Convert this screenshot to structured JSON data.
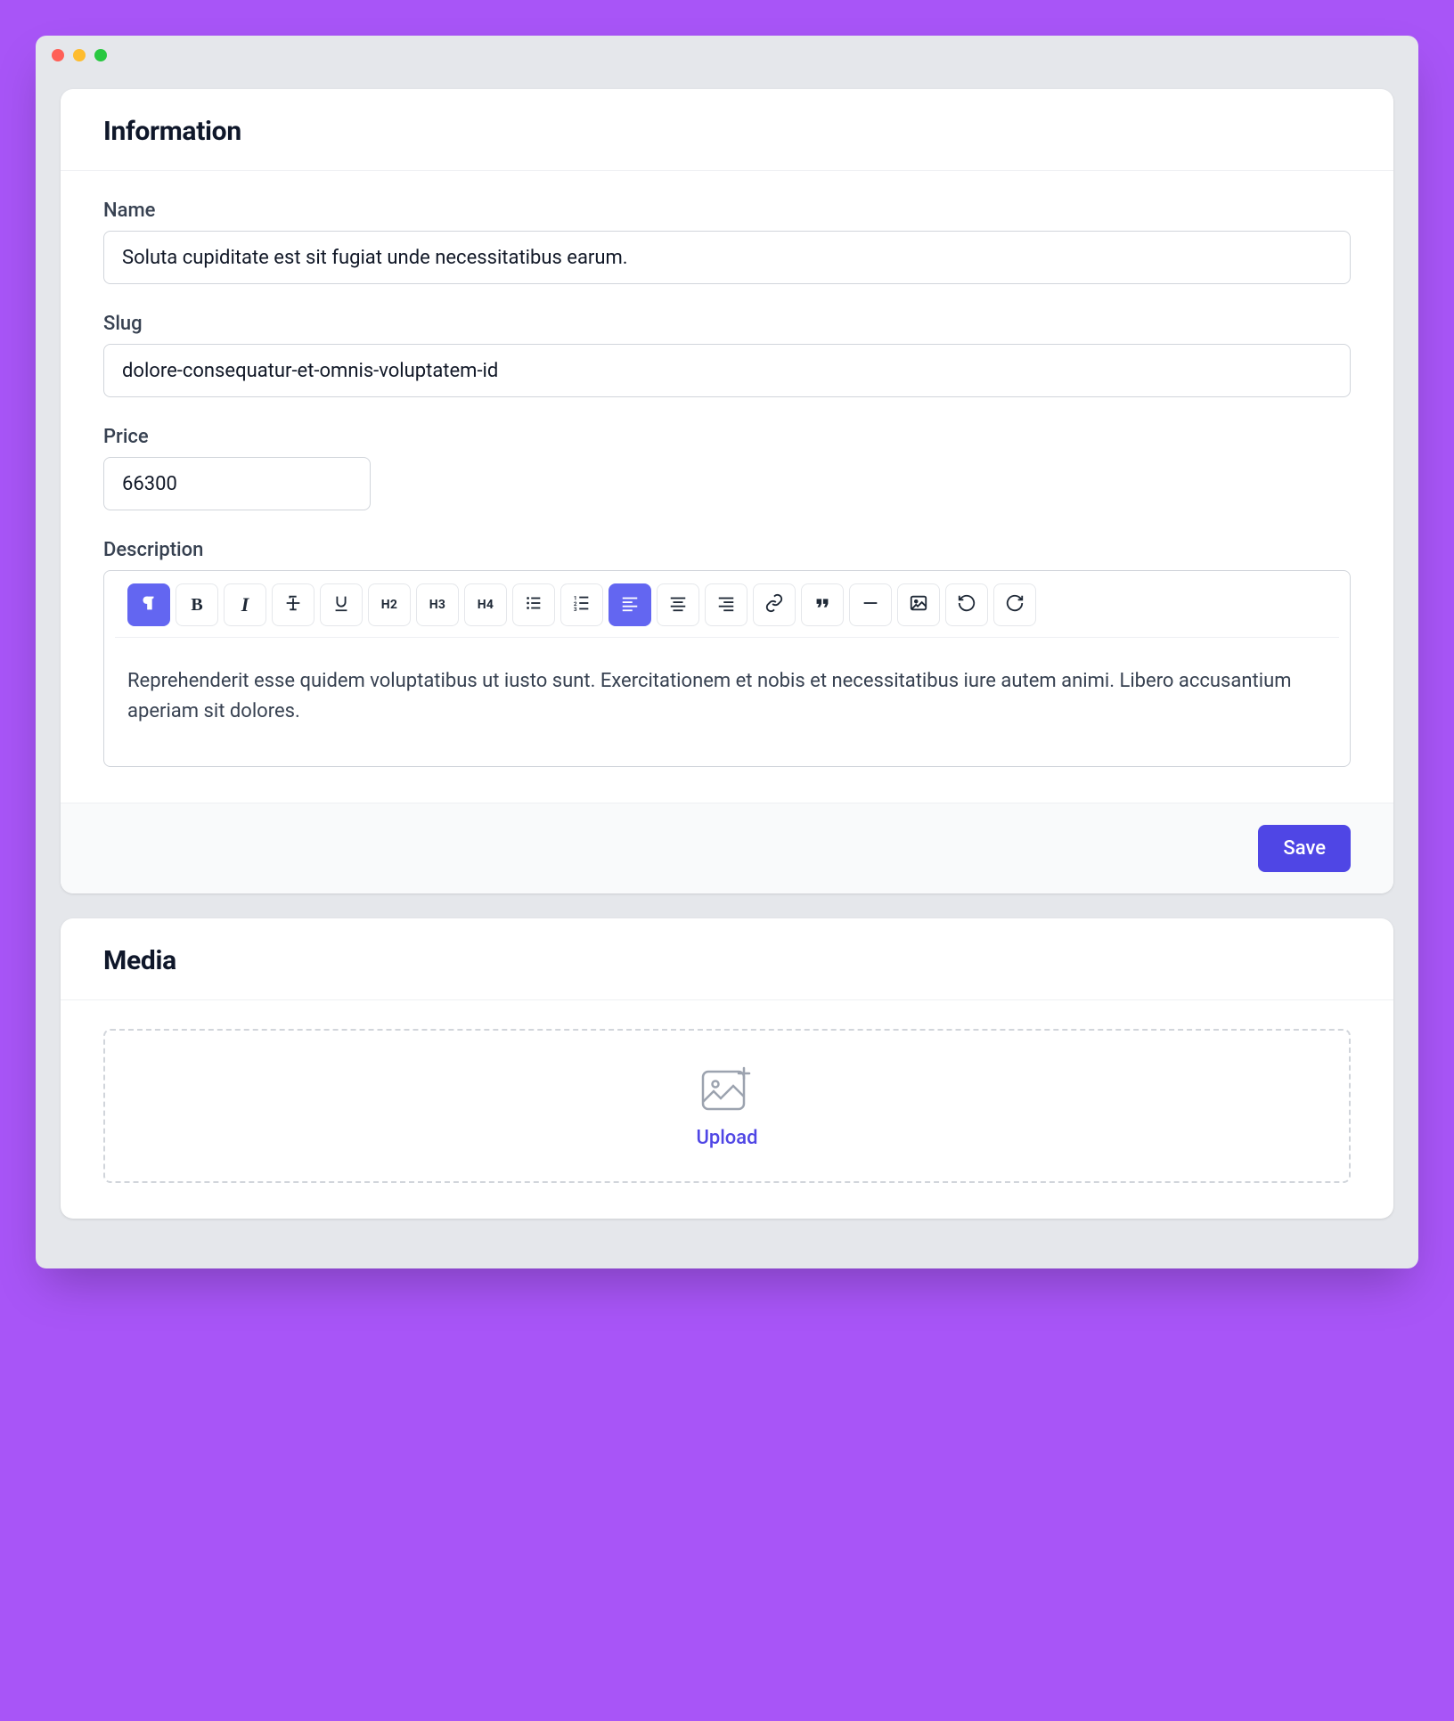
{
  "cards": {
    "information": {
      "title": "Information",
      "fields": {
        "name": {
          "label": "Name",
          "value": "Soluta cupiditate est sit fugiat unde necessitatibus earum."
        },
        "slug": {
          "label": "Slug",
          "value": "dolore-consequatur-et-omnis-voluptatem-id"
        },
        "price": {
          "label": "Price",
          "value": "66300"
        },
        "description": {
          "label": "Description",
          "value": "Reprehenderit esse quidem voluptatibus ut iusto sunt. Exercitationem et nobis et necessitatibus iure autem animi. Libero accusantium aperiam sit dolores."
        }
      },
      "toolbar": {
        "paragraph": {
          "icon": "paragraph-icon",
          "active": true
        },
        "bold": {
          "label": "B"
        },
        "italic": {
          "label": "I"
        },
        "strike": {
          "label": "S"
        },
        "underline": {
          "label": "U"
        },
        "h2": {
          "label": "H2"
        },
        "h3": {
          "label": "H3"
        },
        "h4": {
          "label": "H4"
        },
        "bulletList": {
          "icon": "list-bullet-icon"
        },
        "orderedList": {
          "icon": "list-ordered-icon"
        },
        "alignLeft": {
          "icon": "align-left-icon",
          "active": true
        },
        "alignCenter": {
          "icon": "align-center-icon"
        },
        "alignRight": {
          "icon": "align-right-icon"
        },
        "link": {
          "icon": "link-icon"
        },
        "quote": {
          "icon": "quote-icon"
        },
        "hr": {
          "icon": "minus-icon"
        },
        "image": {
          "icon": "image-icon"
        },
        "undo": {
          "icon": "undo-icon"
        },
        "redo": {
          "icon": "redo-icon"
        }
      },
      "actions": {
        "save": "Save"
      }
    },
    "media": {
      "title": "Media",
      "upload": {
        "label": "Upload"
      }
    }
  }
}
